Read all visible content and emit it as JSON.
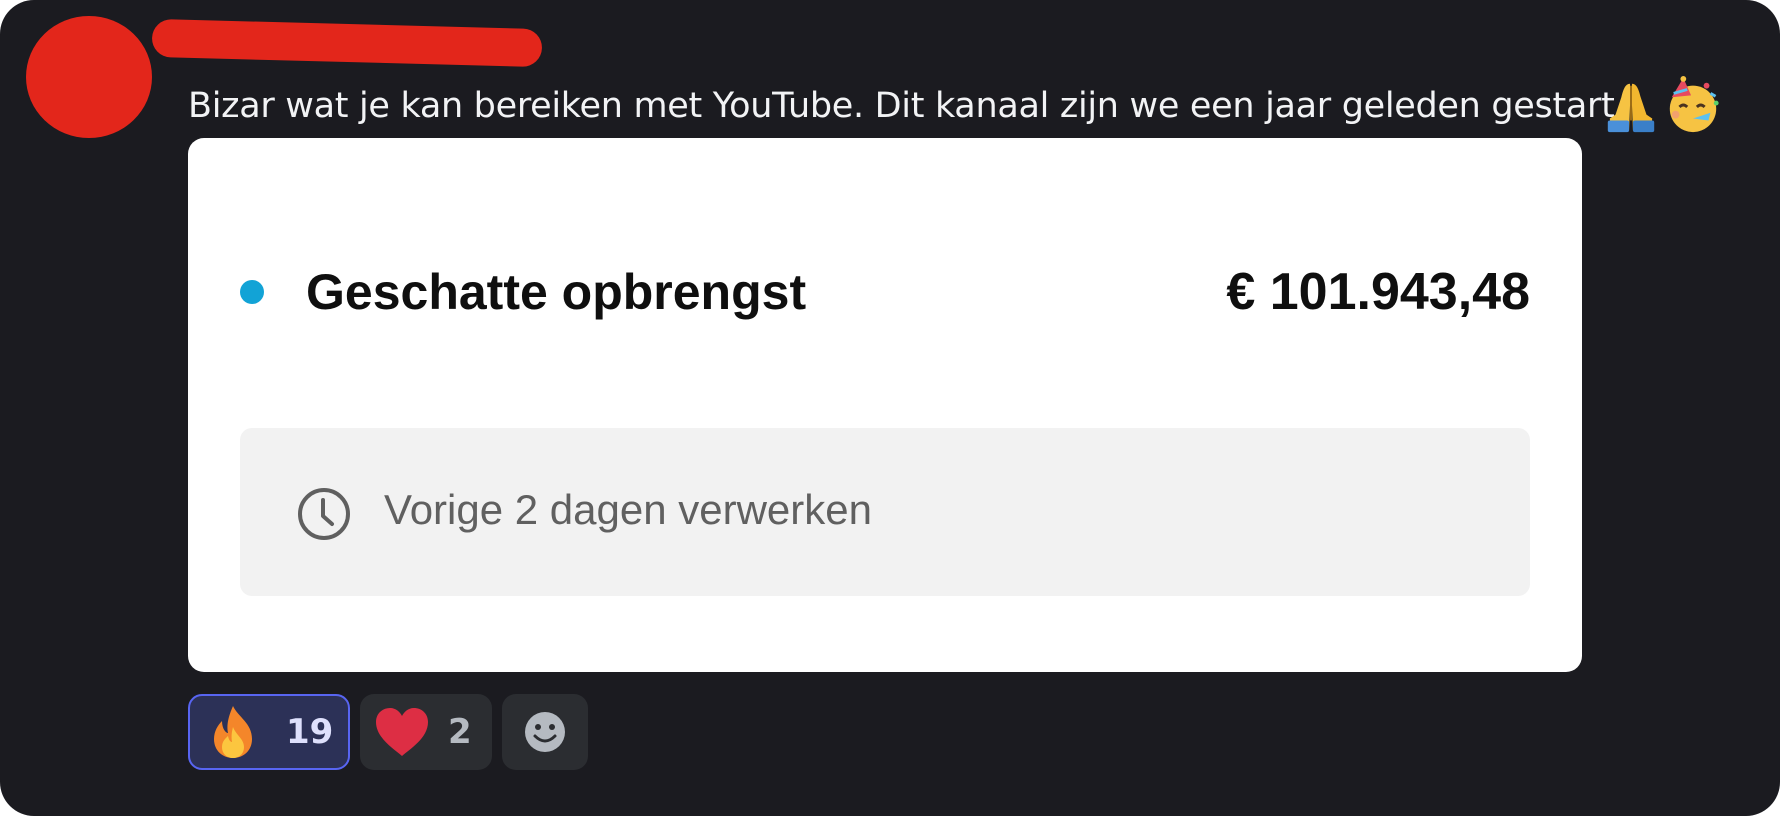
{
  "message": {
    "text": "Bizar wat je kan bereiken met YouTube. Dit kanaal zijn we een jaar geleden gestart.",
    "emojis": [
      "folded-hands",
      "partying-face"
    ]
  },
  "embed": {
    "revenue_label": "Geschatte opbrengst",
    "revenue_value": "€ 101.943,48",
    "indicator_color": "#12a3d6",
    "status_text": "Vorige 2 dagen verwerken",
    "status_icon": "clock-icon"
  },
  "reactions": [
    {
      "emoji": "fire",
      "count": "19",
      "selected": true
    },
    {
      "emoji": "red-heart",
      "count": "2",
      "selected": false
    }
  ],
  "add_reaction": {
    "icon": "smiley-face-icon"
  },
  "colors": {
    "background": "#1b1b20",
    "redaction": "#e3261b",
    "selected_reaction_border": "#5865f2",
    "selected_reaction_bg": "#2c3157"
  }
}
